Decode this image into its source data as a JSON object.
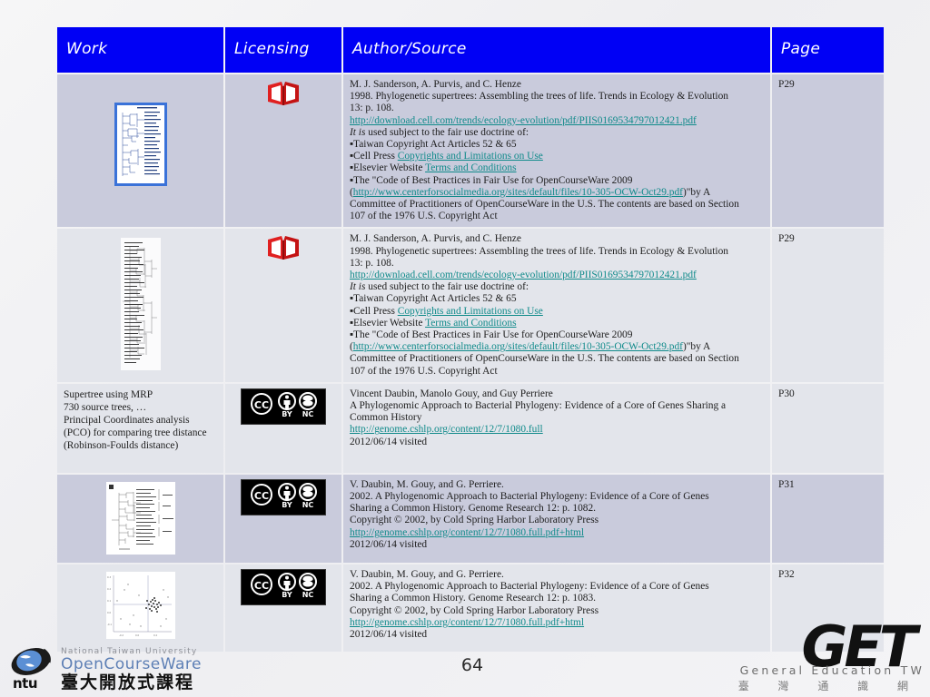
{
  "slide": {
    "page_number": "64",
    "background_color": "#f2f2f2"
  },
  "table": {
    "header_bg": "#0000f5",
    "header_text_color": "#ffffff",
    "row_dark_bg": "#c9cbdc",
    "row_light_bg": "#e3e5eb",
    "link_color": "#0f8a8a",
    "columns": [
      {
        "key": "work",
        "label": "Work"
      },
      {
        "key": "licensing",
        "label": "Licensing"
      },
      {
        "key": "author_source",
        "label": "Author/Source"
      },
      {
        "key": "page",
        "label": "Page"
      }
    ],
    "rows": [
      {
        "work_text": "",
        "work_thumb": "phylogenetic-tree-selected",
        "licensing_icon": "red-open-book-icon",
        "page": "P29",
        "author_source": {
          "lines": [
            {
              "type": "text",
              "value": "M. J. Sanderson, A. Purvis, and C. Henze"
            },
            {
              "type": "text",
              "value": "1998. Phylogenetic supertrees: Assembling the trees of life. Trends in Ecology & Evolution"
            },
            {
              "type": "text",
              "value": "13: p. 108."
            },
            {
              "type": "link",
              "value": "http://download.cell.com/trends/ecology-evolution/pdf/PIIS0169534797012421.pdf"
            },
            {
              "type": "italic_prefix",
              "italic": "It is",
              "value": " used subject to the fair use doctrine of:"
            },
            {
              "type": "text",
              "value": "▪Taiwan Copyright Act Articles 52 & 65"
            },
            {
              "type": "mixed",
              "prefix": "▪Cell Press ",
              "link": "Copyrights and Limitations on Use",
              "suffix": ""
            },
            {
              "type": "mixed",
              "prefix": "▪Elsevier Website ",
              "link": "Terms and Conditions",
              "suffix": ""
            },
            {
              "type": "text",
              "value": "▪The \"Code of Best Practices in Fair Use for OpenCourseWare 2009"
            },
            {
              "type": "mixed",
              "prefix": "(",
              "link": "http://www.centerforsocialmedia.org/sites/default/files/10-305-OCW-Oct29.pdf",
              "suffix": ")\"by A"
            },
            {
              "type": "text",
              "value": "Committee of Practitioners of OpenCourseWare in the U.S. The contents are based on Section"
            },
            {
              "type": "text",
              "value": "107 of the 1976 U.S. Copyright Act"
            }
          ]
        }
      },
      {
        "work_text": "",
        "work_thumb": "cladogram-tall",
        "licensing_icon": "red-open-book-icon",
        "page": "P29",
        "author_source": {
          "lines": [
            {
              "type": "text",
              "value": "M. J. Sanderson, A. Purvis, and C. Henze"
            },
            {
              "type": "text",
              "value": "1998. Phylogenetic supertrees: Assembling the trees of life. Trends in Ecology & Evolution"
            },
            {
              "type": "text",
              "value": "13: p. 108."
            },
            {
              "type": "link",
              "value": "http://download.cell.com/trends/ecology-evolution/pdf/PIIS0169534797012421.pdf"
            },
            {
              "type": "italic_prefix",
              "italic": "It is",
              "value": " used subject to the fair use doctrine of:"
            },
            {
              "type": "text",
              "value": "▪Taiwan Copyright Act Articles 52 & 65"
            },
            {
              "type": "mixed",
              "prefix": "▪Cell Press ",
              "link": "Copyrights and Limitations on Use",
              "suffix": ""
            },
            {
              "type": "mixed",
              "prefix": "▪Elsevier Website ",
              "link": "Terms and Conditions",
              "suffix": ""
            },
            {
              "type": "text",
              "value": "▪The \"Code of Best Practices in Fair Use for OpenCourseWare 2009"
            },
            {
              "type": "mixed",
              "prefix": "(",
              "link": "http://www.centerforsocialmedia.org/sites/default/files/10-305-OCW-Oct29.pdf",
              "suffix": ")\"by A"
            },
            {
              "type": "text",
              "value": "Committee of Practitioners of OpenCourseWare in the U.S. The contents are based on Section"
            },
            {
              "type": "text",
              "value": "107 of the 1976 U.S. Copyright Act"
            }
          ]
        }
      },
      {
        "work_text": "Supertree using MRP\n730 source trees, …\nPrincipal Coordinates analysis\n(PCO) for comparing tree distance\n(Robinson-Foulds distance)",
        "work_thumb": "",
        "licensing_icon": "cc-by-nc-badge",
        "page": "P30",
        "author_source": {
          "lines": [
            {
              "type": "text",
              "value": "Vincent Daubin, Manolo Gouy, and Guy Perriere"
            },
            {
              "type": "text",
              "value": "A Phylogenomic Approach to Bacterial Phylogeny: Evidence of a Core of Genes Sharing a"
            },
            {
              "type": "text",
              "value": "Common History"
            },
            {
              "type": "link",
              "value": "http://genome.cshlp.org/content/12/7/1080.full"
            },
            {
              "type": "text",
              "value": "2012/06/14 visited"
            }
          ]
        }
      },
      {
        "work_text": "",
        "work_thumb": "tree-figure",
        "licensing_icon": "cc-by-nc-badge",
        "page": "P31",
        "author_source": {
          "lines": [
            {
              "type": "text",
              "value": "V. Daubin, M. Gouy, and G. Perriere."
            },
            {
              "type": "text",
              "value": "2002. A Phylogenomic Approach to Bacterial Phylogeny: Evidence of a Core of Genes"
            },
            {
              "type": "text",
              "value": "Sharing a Common History. Genome Research 12: p. 1082."
            },
            {
              "type": "text",
              "value": "Copyright © 2002, by Cold Spring Harbor Laboratory Press"
            },
            {
              "type": "link",
              "value": "http://genome.cshlp.org/content/12/7/1080.full.pdf+html"
            },
            {
              "type": "text",
              "value": "2012/06/14 visited"
            }
          ]
        }
      },
      {
        "work_text": "",
        "work_thumb": "scatter-plot",
        "licensing_icon": "cc-by-nc-badge",
        "page": "P32",
        "author_source": {
          "lines": [
            {
              "type": "text",
              "value": "V. Daubin, M. Gouy, and G. Perriere."
            },
            {
              "type": "text",
              "value": "2002. A Phylogenomic Approach to Bacterial Phylogeny: Evidence of a Core of Genes"
            },
            {
              "type": "text",
              "value": "Sharing a Common History. Genome Research 12: p. 1083."
            },
            {
              "type": "text",
              "value": "Copyright © 2002, by Cold Spring Harbor Laboratory Press"
            },
            {
              "type": "link",
              "value": "http://genome.cshlp.org/content/12/7/1080.full.pdf+html"
            },
            {
              "type": "text",
              "value": "2012/06/14 visited"
            }
          ]
        }
      }
    ]
  },
  "footer": {
    "ocw_logo": {
      "line1": "National Taiwan University",
      "line2": "OpenCourseWare",
      "line3": "臺大開放式課程",
      "mark": "ntu"
    },
    "get_logo": {
      "wordmark": "GET",
      "subtitle_en": "General Education TW",
      "subtitle_zh": "臺 灣 通 識 網"
    }
  },
  "cc_badge": {
    "cc_label": "CC",
    "by_label": "BY",
    "nc_label": "NC"
  }
}
